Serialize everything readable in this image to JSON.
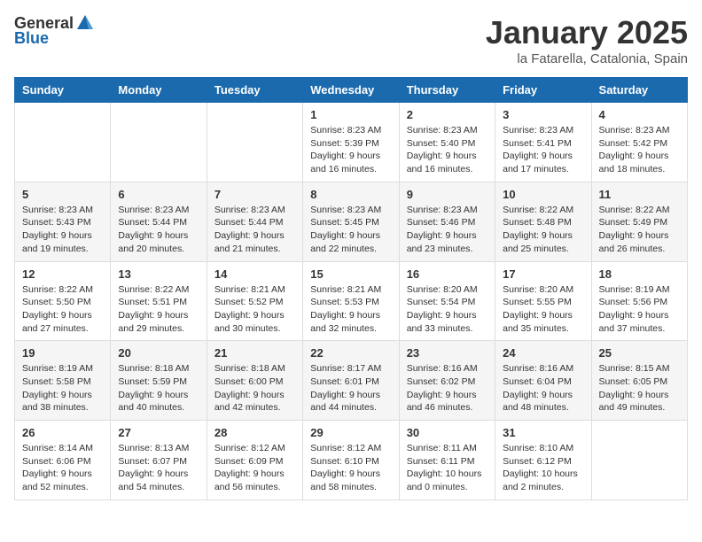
{
  "header": {
    "logo_general": "General",
    "logo_blue": "Blue",
    "month": "January 2025",
    "location": "la Fatarella, Catalonia, Spain"
  },
  "days_of_week": [
    "Sunday",
    "Monday",
    "Tuesday",
    "Wednesday",
    "Thursday",
    "Friday",
    "Saturday"
  ],
  "weeks": [
    [
      {
        "day": "",
        "info": ""
      },
      {
        "day": "",
        "info": ""
      },
      {
        "day": "",
        "info": ""
      },
      {
        "day": "1",
        "info": "Sunrise: 8:23 AM\nSunset: 5:39 PM\nDaylight: 9 hours and 16 minutes."
      },
      {
        "day": "2",
        "info": "Sunrise: 8:23 AM\nSunset: 5:40 PM\nDaylight: 9 hours and 16 minutes."
      },
      {
        "day": "3",
        "info": "Sunrise: 8:23 AM\nSunset: 5:41 PM\nDaylight: 9 hours and 17 minutes."
      },
      {
        "day": "4",
        "info": "Sunrise: 8:23 AM\nSunset: 5:42 PM\nDaylight: 9 hours and 18 minutes."
      }
    ],
    [
      {
        "day": "5",
        "info": "Sunrise: 8:23 AM\nSunset: 5:43 PM\nDaylight: 9 hours and 19 minutes."
      },
      {
        "day": "6",
        "info": "Sunrise: 8:23 AM\nSunset: 5:44 PM\nDaylight: 9 hours and 20 minutes."
      },
      {
        "day": "7",
        "info": "Sunrise: 8:23 AM\nSunset: 5:44 PM\nDaylight: 9 hours and 21 minutes."
      },
      {
        "day": "8",
        "info": "Sunrise: 8:23 AM\nSunset: 5:45 PM\nDaylight: 9 hours and 22 minutes."
      },
      {
        "day": "9",
        "info": "Sunrise: 8:23 AM\nSunset: 5:46 PM\nDaylight: 9 hours and 23 minutes."
      },
      {
        "day": "10",
        "info": "Sunrise: 8:22 AM\nSunset: 5:48 PM\nDaylight: 9 hours and 25 minutes."
      },
      {
        "day": "11",
        "info": "Sunrise: 8:22 AM\nSunset: 5:49 PM\nDaylight: 9 hours and 26 minutes."
      }
    ],
    [
      {
        "day": "12",
        "info": "Sunrise: 8:22 AM\nSunset: 5:50 PM\nDaylight: 9 hours and 27 minutes."
      },
      {
        "day": "13",
        "info": "Sunrise: 8:22 AM\nSunset: 5:51 PM\nDaylight: 9 hours and 29 minutes."
      },
      {
        "day": "14",
        "info": "Sunrise: 8:21 AM\nSunset: 5:52 PM\nDaylight: 9 hours and 30 minutes."
      },
      {
        "day": "15",
        "info": "Sunrise: 8:21 AM\nSunset: 5:53 PM\nDaylight: 9 hours and 32 minutes."
      },
      {
        "day": "16",
        "info": "Sunrise: 8:20 AM\nSunset: 5:54 PM\nDaylight: 9 hours and 33 minutes."
      },
      {
        "day": "17",
        "info": "Sunrise: 8:20 AM\nSunset: 5:55 PM\nDaylight: 9 hours and 35 minutes."
      },
      {
        "day": "18",
        "info": "Sunrise: 8:19 AM\nSunset: 5:56 PM\nDaylight: 9 hours and 37 minutes."
      }
    ],
    [
      {
        "day": "19",
        "info": "Sunrise: 8:19 AM\nSunset: 5:58 PM\nDaylight: 9 hours and 38 minutes."
      },
      {
        "day": "20",
        "info": "Sunrise: 8:18 AM\nSunset: 5:59 PM\nDaylight: 9 hours and 40 minutes."
      },
      {
        "day": "21",
        "info": "Sunrise: 8:18 AM\nSunset: 6:00 PM\nDaylight: 9 hours and 42 minutes."
      },
      {
        "day": "22",
        "info": "Sunrise: 8:17 AM\nSunset: 6:01 PM\nDaylight: 9 hours and 44 minutes."
      },
      {
        "day": "23",
        "info": "Sunrise: 8:16 AM\nSunset: 6:02 PM\nDaylight: 9 hours and 46 minutes."
      },
      {
        "day": "24",
        "info": "Sunrise: 8:16 AM\nSunset: 6:04 PM\nDaylight: 9 hours and 48 minutes."
      },
      {
        "day": "25",
        "info": "Sunrise: 8:15 AM\nSunset: 6:05 PM\nDaylight: 9 hours and 49 minutes."
      }
    ],
    [
      {
        "day": "26",
        "info": "Sunrise: 8:14 AM\nSunset: 6:06 PM\nDaylight: 9 hours and 52 minutes."
      },
      {
        "day": "27",
        "info": "Sunrise: 8:13 AM\nSunset: 6:07 PM\nDaylight: 9 hours and 54 minutes."
      },
      {
        "day": "28",
        "info": "Sunrise: 8:12 AM\nSunset: 6:09 PM\nDaylight: 9 hours and 56 minutes."
      },
      {
        "day": "29",
        "info": "Sunrise: 8:12 AM\nSunset: 6:10 PM\nDaylight: 9 hours and 58 minutes."
      },
      {
        "day": "30",
        "info": "Sunrise: 8:11 AM\nSunset: 6:11 PM\nDaylight: 10 hours and 0 minutes."
      },
      {
        "day": "31",
        "info": "Sunrise: 8:10 AM\nSunset: 6:12 PM\nDaylight: 10 hours and 2 minutes."
      },
      {
        "day": "",
        "info": ""
      }
    ]
  ]
}
